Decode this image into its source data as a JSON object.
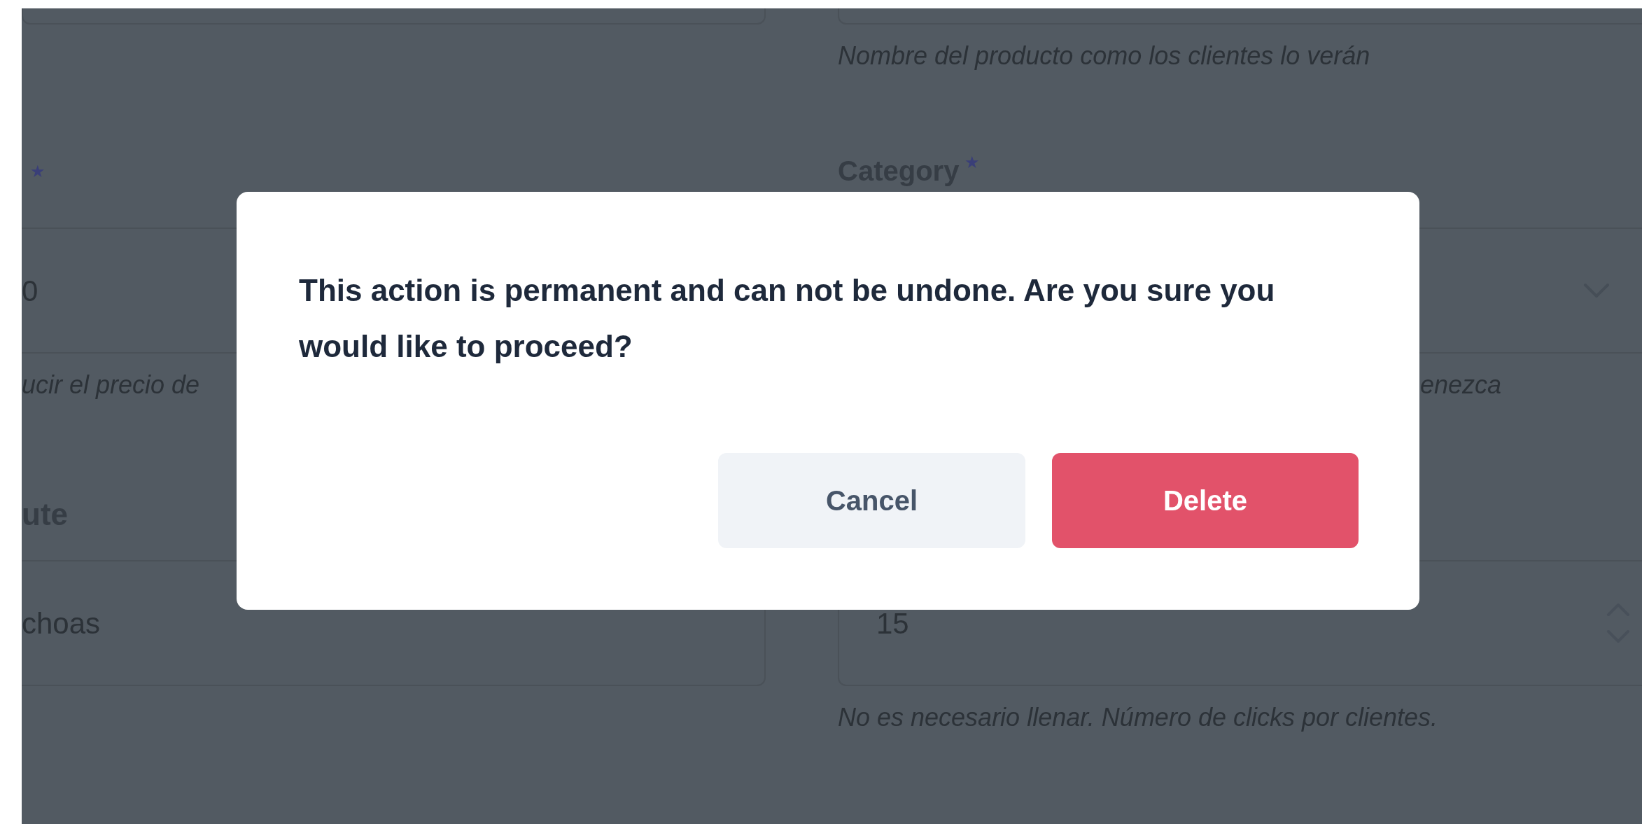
{
  "form_left": {
    "required_mark": "★",
    "field_1_value": "0",
    "field_1_help": "ucir el precio de",
    "label_2": "ute",
    "field_2_value": "choas"
  },
  "form_right": {
    "field_0_help": "Nombre del producto como los clientes lo verán",
    "label_1": "Category",
    "required_mark": "★",
    "field_1_help": "enezca",
    "field_2_value": "15",
    "field_2_help": "No es necesario llenar. Número de clicks por clientes."
  },
  "dialog": {
    "message": "This action is permanent and can not be undone. Are you sure you would like to proceed?",
    "buttons": [
      {
        "label": "Cancel",
        "kind": "secondary"
      },
      {
        "label": "Delete",
        "kind": "danger"
      }
    ]
  }
}
